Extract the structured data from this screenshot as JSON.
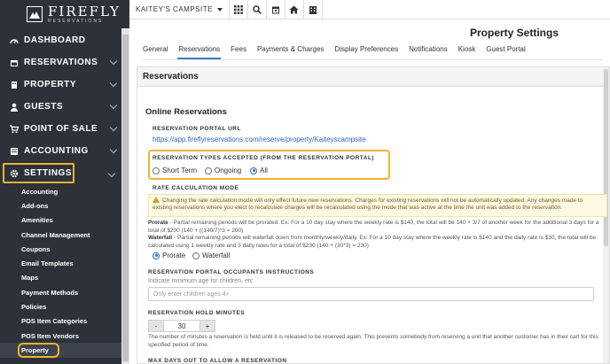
{
  "brand": {
    "name": "FIREFLY",
    "sub": "RESERVATIONS"
  },
  "nav": [
    {
      "label": "DASHBOARD",
      "icon": "dashboard-icon",
      "chevron": false
    },
    {
      "label": "RESERVATIONS",
      "icon": "calendar-icon",
      "chevron": true
    },
    {
      "label": "PROPERTY",
      "icon": "building-icon",
      "chevron": true
    },
    {
      "label": "GUESTS",
      "icon": "user-icon",
      "chevron": true
    },
    {
      "label": "POINT OF SALE",
      "icon": "cart-icon",
      "chevron": true
    },
    {
      "label": "ACCOUNTING",
      "icon": "accounting-icon",
      "chevron": true
    },
    {
      "label": "SETTINGS",
      "icon": "gear-icon",
      "chevron": true
    }
  ],
  "settings_sub": [
    "Accounting",
    "Add-ons",
    "Amenities",
    "Channel Management",
    "Coupons",
    "Email Templates",
    "Maps",
    "Payment Methods",
    "Policies",
    "POS Item Categories",
    "POS Item Vendors",
    "Property"
  ],
  "topbar": {
    "campsite": "KAITEY'S CAMPSITE",
    "buttons": [
      "grid-icon",
      "search-icon",
      "calendar-icon",
      "home-icon",
      "building-icon"
    ]
  },
  "page_title": "Property Settings",
  "tabs": [
    "General",
    "Reservations",
    "Fees",
    "Payments & Charges",
    "Display Preferences",
    "Notifications",
    "Kiosk",
    "Guest Portal"
  ],
  "panel": {
    "title": "Reservations",
    "section": "Online Reservations",
    "portal_url_label": "RESERVATION PORTAL URL",
    "portal_url": "https://app.fireflyreservations.com/reserve/property/Kaiteyscampsite",
    "types_label": "RESERVATION TYPES ACCEPTED (FROM THE RESERVATION PORTAL)",
    "types": [
      "Short Term",
      "Ongoing",
      "All"
    ],
    "rate_label": "RATE CALCULATION MODE",
    "warning": "Changing the rate calculation mode will only effect future new reservations. Charges for existing reservations will not be automatically updated. Any changes made to existing reservations where you elect to recalculate charges will be recalculated using the mode that was active at the time the unit was added to the reservation.",
    "prorate_title": "Prorate",
    "prorate_text": " - Partial remaining periods will be prorated. Ex: For a 10 day stay where the weekly rate is $140, the total will be 140 + 3/7 of another week for the additional 3 days for a total of $200 (140 + ((140/7)*3 = 200)",
    "waterfall_title": "Waterfall",
    "waterfall_text": " - Partial remaining periods will waterfall down from monthly/weekly/daily. Ex: For a 10 day stay where the weekly rate is $140 and the daily rate is $30, the total will be calculated using 1 weekly rate and 3 daily rates for a total of $230 (140 + (30*3) = 230)",
    "modes": [
      "Prorate",
      "Waterfall"
    ],
    "occupants_label": "RESERVATION PORTAL OCCUPANTS INSTRUCTIONS",
    "occupants_hint": "Indicate minimum age for children, etc",
    "occupants_placeholder": "Only enter children ages 4+",
    "hold_label": "RESERVATION HOLD MINUTES",
    "hold_value": "30",
    "minus": "-",
    "plus": "+",
    "hold_text": "The number of minutes a reservation is held until it is released to be reserved again. This prevents somebody from reserving a unit that another customer has in their cart for this specified period of time.",
    "maxdays_label": "MAX DAYS OUT TO ALLOW A RESERVATION"
  },
  "colors": {
    "sidebar": "#2d323a",
    "highlight": "#f0b232",
    "link": "#2a6bb7"
  }
}
